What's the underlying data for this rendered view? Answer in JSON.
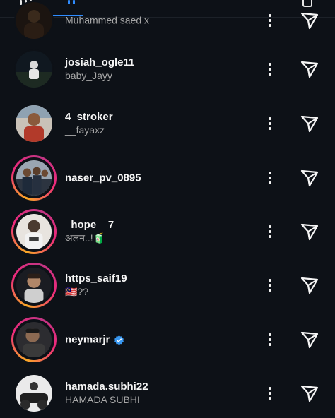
{
  "header": {
    "tabs": [
      {
        "icon": "grid-icon",
        "active": false
      },
      {
        "icon": "reels-icon",
        "active": true
      }
    ],
    "right_icon": "trash-icon",
    "accent_color": "#2f8cff"
  },
  "rows": [
    {
      "username": "",
      "subtitle": "Muhammed  saed x",
      "story": false,
      "verified": false
    },
    {
      "username": "josiah_ogle11",
      "subtitle": "baby_Jayy",
      "story": false,
      "verified": false
    },
    {
      "username": "4_stroker____",
      "subtitle": "__fayaxz",
      "story": false,
      "verified": false
    },
    {
      "username": "naser_pv_0895",
      "subtitle": "",
      "story": true,
      "verified": false
    },
    {
      "username": "_hope__7_",
      "subtitle": "अलन..!🧃",
      "story": true,
      "verified": false
    },
    {
      "username": "https_saif19",
      "subtitle": "🇲🇾??",
      "story": true,
      "verified": false
    },
    {
      "username": "neymarjr",
      "subtitle": "",
      "story": true,
      "verified": true
    },
    {
      "username": "hamada.subhi22",
      "subtitle": "HAMADA SUBHI",
      "story": false,
      "verified": false
    }
  ],
  "icons": {
    "more": "more-vertical-icon",
    "send": "send-icon",
    "verified": "verified-badge-icon"
  }
}
